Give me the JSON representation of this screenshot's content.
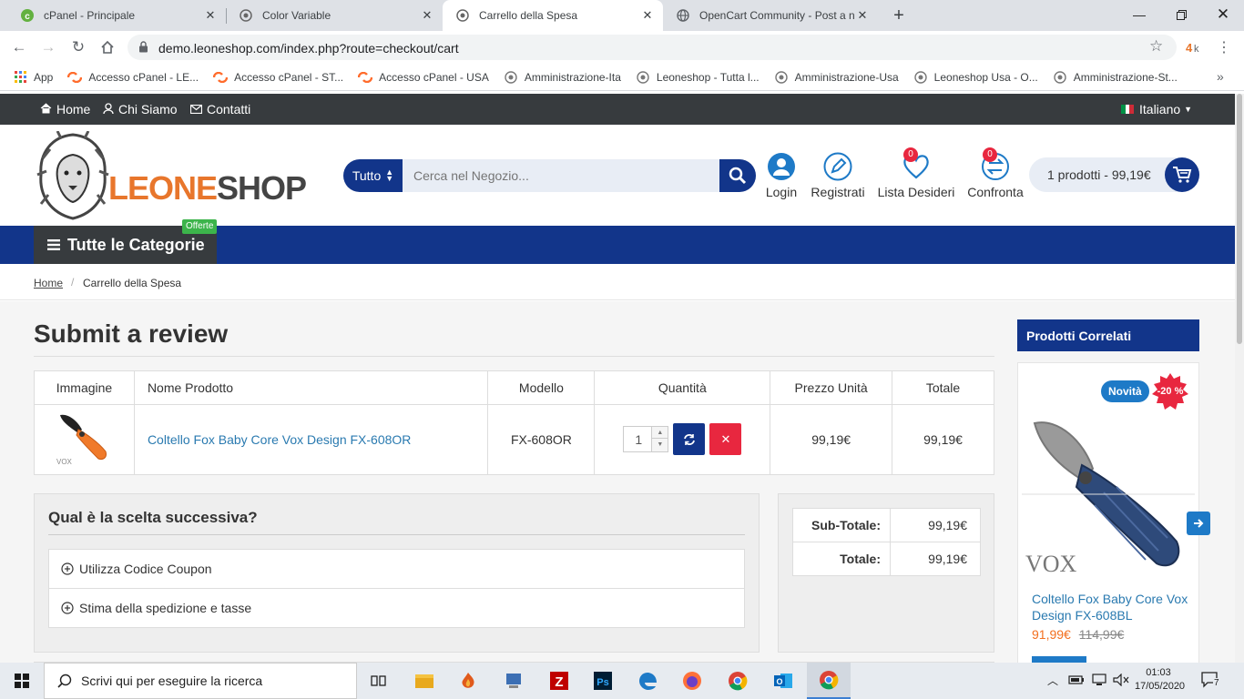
{
  "browser": {
    "tabs": [
      {
        "title": "cPanel - Principale",
        "icon": "cpanel-icon"
      },
      {
        "title": "Color Variable",
        "icon": "lion-icon"
      },
      {
        "title": "Carrello della Spesa",
        "icon": "lion-icon",
        "active": true
      },
      {
        "title": "OpenCart Community - Post a ne",
        "icon": "globe-icon"
      }
    ],
    "url": "demo.leoneshop.com/index.php?route=checkout/cart",
    "bookmarks": [
      {
        "label": "App",
        "icon": "apps-icon"
      },
      {
        "label": "Accesso cPanel - LE...",
        "icon": "cpanel-icon"
      },
      {
        "label": "Accesso cPanel - ST...",
        "icon": "cpanel-icon"
      },
      {
        "label": "Accesso cPanel - USA",
        "icon": "cpanel-icon"
      },
      {
        "label": "Amministrazione-Ita",
        "icon": "lion-icon"
      },
      {
        "label": "Leoneshop - Tutta l...",
        "icon": "lion-icon"
      },
      {
        "label": "Amministrazione-Usa",
        "icon": "lion-icon"
      },
      {
        "label": "Leoneshop Usa - O...",
        "icon": "lion-icon"
      },
      {
        "label": "Amministrazione-St...",
        "icon": "lion-icon"
      }
    ]
  },
  "site": {
    "topnav": {
      "home": "Home",
      "about": "Chi Siamo",
      "contacts": "Contatti",
      "language": "Italiano"
    },
    "logo": {
      "part1": "LEONE",
      "part2": "SHOP"
    },
    "search": {
      "category": "Tutto",
      "placeholder": "Cerca nel Negozio..."
    },
    "actions": {
      "login": "Login",
      "register": "Registrati",
      "wishlist": "Lista Desideri",
      "wishlist_count": "0",
      "compare": "Confronta",
      "compare_count": "0"
    },
    "cart_button": "1 prodotti - 99,19€",
    "categories": {
      "label": "Tutte le Categorie",
      "badge": "Offerte"
    },
    "breadcrumb": {
      "home": "Home",
      "current": "Carrello della Spesa"
    },
    "page_title": "Submit a review",
    "cart_table": {
      "headers": [
        "Immagine",
        "Nome Prodotto",
        "Modello",
        "Quantità",
        "Prezzo Unità",
        "Totale"
      ],
      "rows": [
        {
          "name": "Coltello Fox Baby Core Vox Design FX-608OR",
          "model": "FX-608OR",
          "qty": "1",
          "unit_price": "99,19€",
          "total": "99,19€"
        }
      ]
    },
    "next_step": {
      "title": "Qual è la scelta successiva?",
      "coupon": "Utilizza Codice Coupon",
      "shipping": "Stima della spedizione e tasse"
    },
    "totals": {
      "subtotal_label": "Sub-Totale:",
      "subtotal": "99,19€",
      "total_label": "Totale:",
      "total": "99,19€"
    },
    "related": {
      "title": "Prodotti Correlati",
      "badge_new": "Novità",
      "badge_discount": "-20 %",
      "product_name": "Coltello Fox Baby Core Vox Design FX-608BL",
      "price": "91,99€",
      "old_price": "114,99€",
      "brand": "VOX"
    }
  },
  "taskbar": {
    "search_placeholder": "Scrivi qui per eseguire la ricerca",
    "time": "01:03",
    "date": "17/05/2020",
    "notifications": "7"
  },
  "colors": {
    "brand_blue": "#12358a",
    "topbar": "#373b3e",
    "logo_orange": "#e8762c",
    "link": "#2a7ab0",
    "danger": "#e8273f",
    "price_orange": "#f36f1f"
  }
}
